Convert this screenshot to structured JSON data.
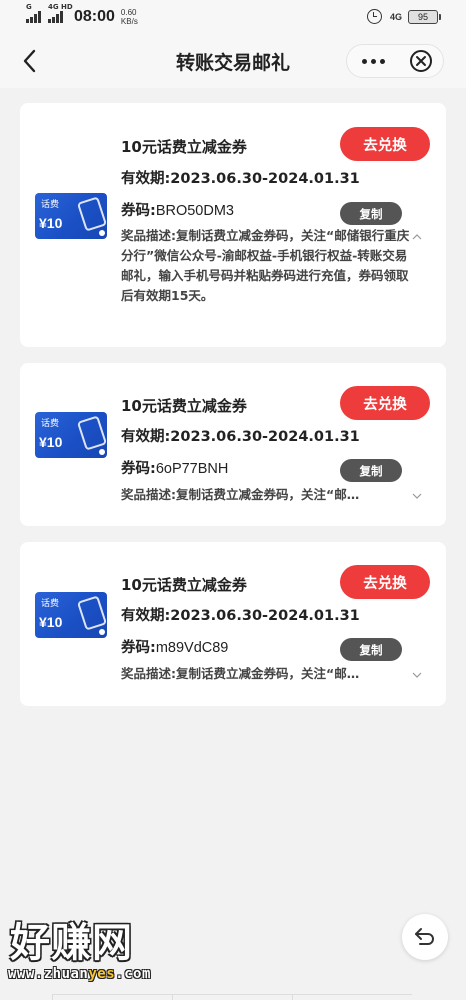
{
  "status_bar": {
    "net_left": "G",
    "net_right": "4G HD",
    "time": "08:00",
    "speed_value": "0.60",
    "speed_unit": "KB/s",
    "network": "4G",
    "battery": "95"
  },
  "header": {
    "title": "转账交易邮礼",
    "back_icon": "chevron-left-icon",
    "more_icon": "more-dots-icon",
    "close_icon": "close-circle-icon"
  },
  "coupons": [
    {
      "img_tag": "话费",
      "img_amount": "¥10",
      "title": "10元话费立减金券",
      "validity": "有效期:2023.06.30-2024.01.31",
      "code_label": "券码:",
      "code": "BRO50DM3",
      "redeem_label": "去兑换",
      "copy_label": "复制",
      "description": "奖品描述:复制话费立减金券码，关注“邮储银行重庆分行”微信公众号-渝邮权益-手机银行权益-转账交易邮礼，输入手机号码并粘贴券码进行充值，券码领取后有效期15天。",
      "expanded": true
    },
    {
      "img_tag": "话费",
      "img_amount": "¥10",
      "title": "10元话费立减金券",
      "validity": "有效期:2023.06.30-2024.01.31",
      "code_label": "券码:",
      "code": "6oP77BNH",
      "redeem_label": "去兑换",
      "copy_label": "复制",
      "description": "奖品描述:复制话费立减金券码，关注“邮…",
      "expanded": false
    },
    {
      "img_tag": "话费",
      "img_amount": "¥10",
      "title": "10元话费立减金券",
      "validity": "有效期:2023.06.30-2024.01.31",
      "code_label": "券码:",
      "code": "m89VdC89",
      "redeem_label": "去兑换",
      "copy_label": "复制",
      "description": "奖品描述:复制话费立减金券码，关注“邮…",
      "expanded": false
    }
  ],
  "watermark": {
    "cn": "好赚网",
    "url_a": "www.zhuan",
    "url_b": "yes",
    "url_c": ".com"
  },
  "colors": {
    "accent_red": "#ee3b3b",
    "coupon_blue": "#1a4fc4",
    "copy_gray": "#555555"
  }
}
